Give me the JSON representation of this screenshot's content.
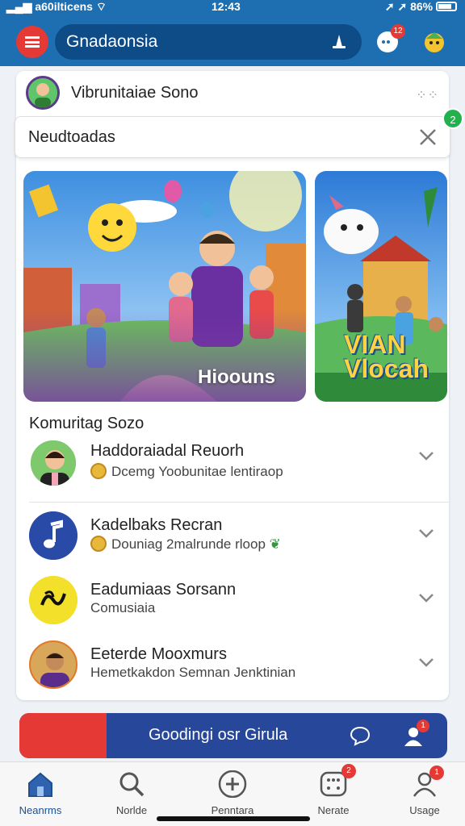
{
  "status_bar": {
    "carrier": "a60ilticens",
    "time": "12:43",
    "battery": "86%"
  },
  "header": {
    "search_text": "Gnadaonsia",
    "notif_badge": "12",
    "accent": "#1d6fb2",
    "menu_color": "#e53935"
  },
  "profile": {
    "name": "Vibrunitaiae Sono",
    "more_icon": "more-dots-icon"
  },
  "filter": {
    "text": "Neudtoadas",
    "badge": "2"
  },
  "banners": [
    {
      "caption": "Hioouns"
    },
    {
      "caption": "VIAN Vlocah"
    }
  ],
  "section": {
    "title": "Komuritag Sozo"
  },
  "list": [
    {
      "title": "Haddoraiadal Reuorh",
      "subtitle": "Dcemg Yoobunitae lentiraop",
      "avatar_color": "#f4c7a1"
    },
    {
      "title": "Kadelbaks Recran",
      "subtitle": "Douniag 2malrunde rloop",
      "avatar_color": "#2a4aa8"
    },
    {
      "title": "Eadumiaas Sorsann",
      "subtitle": "Comusiaia",
      "avatar_color": "#f2e02a"
    },
    {
      "title": "Eeterde Mooxmurs",
      "subtitle": "Hemetkakdon Semnan Jenktinian",
      "avatar_color": "#e07a2a"
    }
  ],
  "promo": {
    "text": "Goodingi osr Girula",
    "user_badge": "1"
  },
  "tabs": [
    {
      "label": "Neanrms",
      "icon": "home-icon"
    },
    {
      "label": "Norlde",
      "icon": "search-icon"
    },
    {
      "label": "Penntara",
      "icon": "plus-icon"
    },
    {
      "label": "Nerate",
      "icon": "dice-icon",
      "badge": "2"
    },
    {
      "label": "Usage",
      "icon": "user-icon",
      "badge": "1"
    }
  ]
}
